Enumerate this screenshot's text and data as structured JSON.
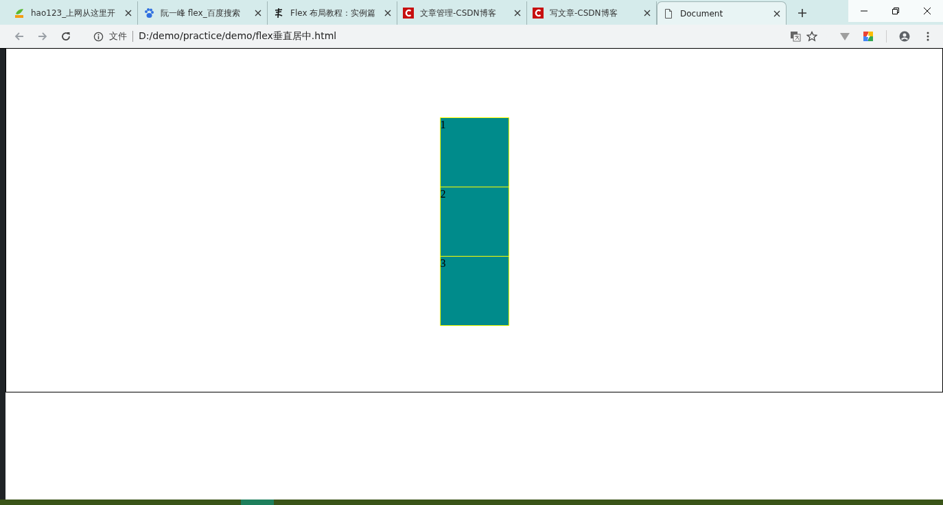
{
  "tabs": [
    {
      "title": "hao123_上网从这里开",
      "kind": "leaf",
      "selected": false
    },
    {
      "title": "阮一峰 flex_百度搜索",
      "kind": "paw",
      "selected": false
    },
    {
      "title": "Flex 布局教程：实例篇",
      "kind": "glyph",
      "selected": false
    },
    {
      "title": "文章管理-CSDN博客",
      "kind": "clogo",
      "selected": false
    },
    {
      "title": "写文章-CSDN博客",
      "kind": "clogo",
      "selected": false
    },
    {
      "title": "Document",
      "kind": "page",
      "selected": true
    }
  ],
  "address_bar": {
    "scheme_label": "文件",
    "url": "D:/demo/practice/demo/flex垂直居中.html"
  },
  "page": {
    "boxes": [
      "1",
      "2",
      "3"
    ]
  }
}
